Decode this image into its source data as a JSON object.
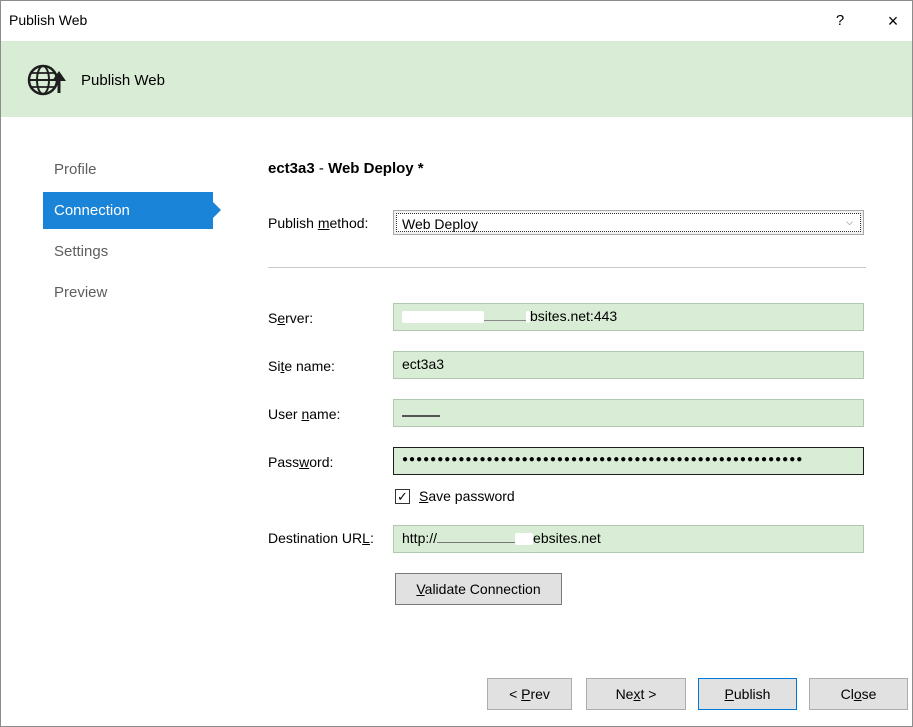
{
  "window": {
    "title": "Publish Web",
    "help_label": "?",
    "close_label": "×"
  },
  "banner": {
    "title": "Publish Web",
    "icon": "globe-publish-icon",
    "background": "#d9edd6"
  },
  "nav": {
    "items": [
      {
        "label": "Profile",
        "active": false
      },
      {
        "label": "Connection",
        "active": true
      },
      {
        "label": "Settings",
        "active": false
      },
      {
        "label": "Preview",
        "active": false
      }
    ],
    "active_color": "#1a84d8"
  },
  "main": {
    "profile_name": "ect3a3",
    "separator": " - ",
    "profile_type": "Web Deploy *",
    "publish_method": {
      "label_pre": "Publish ",
      "label_accel": "m",
      "label_post": "ethod:",
      "value": "Web Deploy"
    },
    "server": {
      "label_pre": "S",
      "label_accel": "e",
      "label_post": "rver:",
      "value_suffix": "bsites.net:443"
    },
    "site_name": {
      "label_pre": "Si",
      "label_accel": "t",
      "label_post": "e name:",
      "value": "ect3a3"
    },
    "user_name": {
      "label_pre": "User ",
      "label_accel": "n",
      "label_post": "ame:"
    },
    "password": {
      "label_pre": "Pass",
      "label_accel": "w",
      "label_post": "ord:",
      "value": "●●●●●●●●●●●●●●●●●●●●●●●●●●●●●●●●●●●●●●●●●●●●●●●●●●●●●●●●●"
    },
    "save_password": {
      "checked": true,
      "check_mark": "✓",
      "label_accel": "S",
      "label_post": "ave password"
    },
    "destination_url": {
      "label_pre": "Destination UR",
      "label_accel": "L",
      "label_post": ":",
      "value_prefix": "http://",
      "value_suffix": "ebsites.net"
    },
    "validate_button": {
      "label_accel": "V",
      "label_post": "alidate Connection"
    }
  },
  "footer": {
    "prev": {
      "label_pre": "< ",
      "label_accel": "P",
      "label_post": "rev"
    },
    "next": {
      "label_pre": "Ne",
      "label_accel": "x",
      "label_post": "t >"
    },
    "publish": {
      "label_accel": "P",
      "label_post": "ublish"
    },
    "close": {
      "label_pre": "Cl",
      "label_accel": "o",
      "label_post": "se"
    }
  }
}
